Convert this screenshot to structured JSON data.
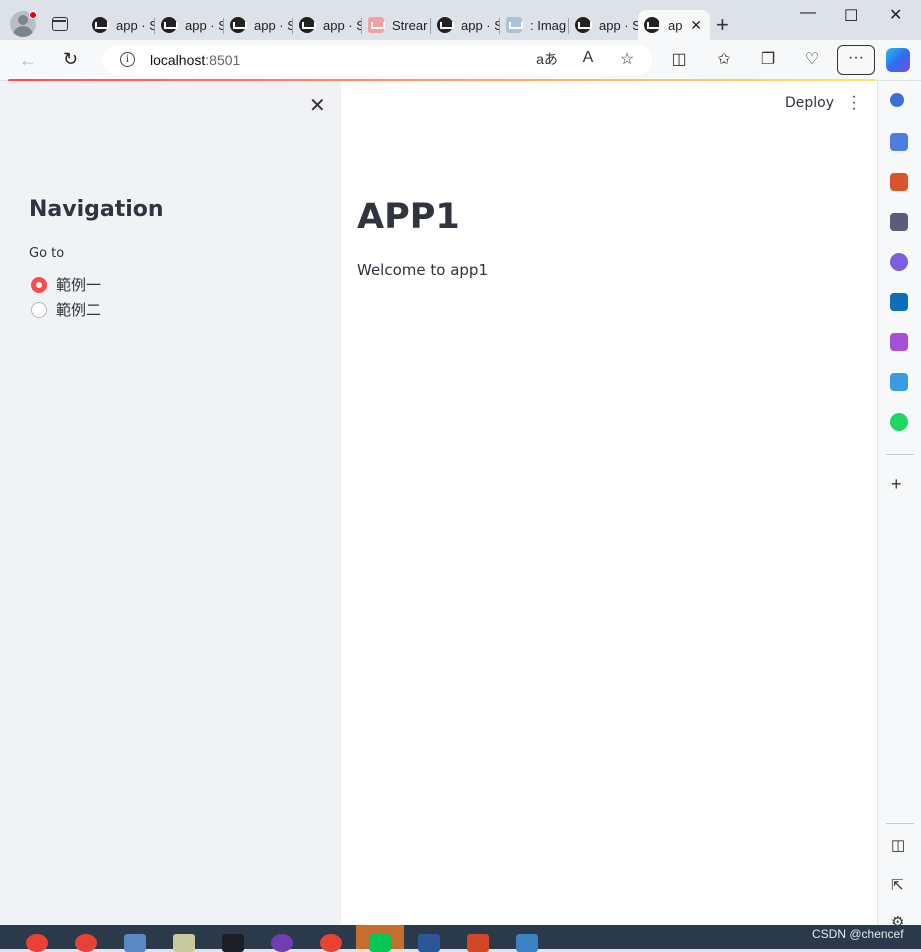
{
  "browser": {
    "tabs": [
      {
        "label": "app · S",
        "favicon": "streamlit-crown-icon"
      },
      {
        "label": "app · S",
        "favicon": "streamlit-crown-icon"
      },
      {
        "label": "app · S",
        "favicon": "streamlit-crown-icon"
      },
      {
        "label": "app · S",
        "favicon": "streamlit-crown-icon"
      },
      {
        "label": "Strear",
        "favicon": "streamlit-logo-icon"
      },
      {
        "label": "app · S",
        "favicon": "streamlit-crown-icon"
      },
      {
        "label": ": Imag",
        "favicon": "image-icon"
      },
      {
        "label": "app · S",
        "favicon": "streamlit-crown-icon"
      },
      {
        "label": "ap",
        "favicon": "streamlit-crown-icon",
        "active": true
      }
    ],
    "address": {
      "host": "localhost",
      "port": ":8501"
    }
  },
  "sidebar": {
    "title": "Navigation",
    "radio_label": "Go to",
    "options": [
      {
        "label": "範例一",
        "selected": true
      },
      {
        "label": "範例二",
        "selected": false
      }
    ]
  },
  "header": {
    "deploy_label": "Deploy"
  },
  "main": {
    "title": "APP1",
    "text": "Welcome to app1"
  },
  "watermark": "CSDN @chencef",
  "colors": {
    "accent": "#ff4b4b",
    "sidebar_bg": "#f0f2f6",
    "text": "#31333f"
  }
}
